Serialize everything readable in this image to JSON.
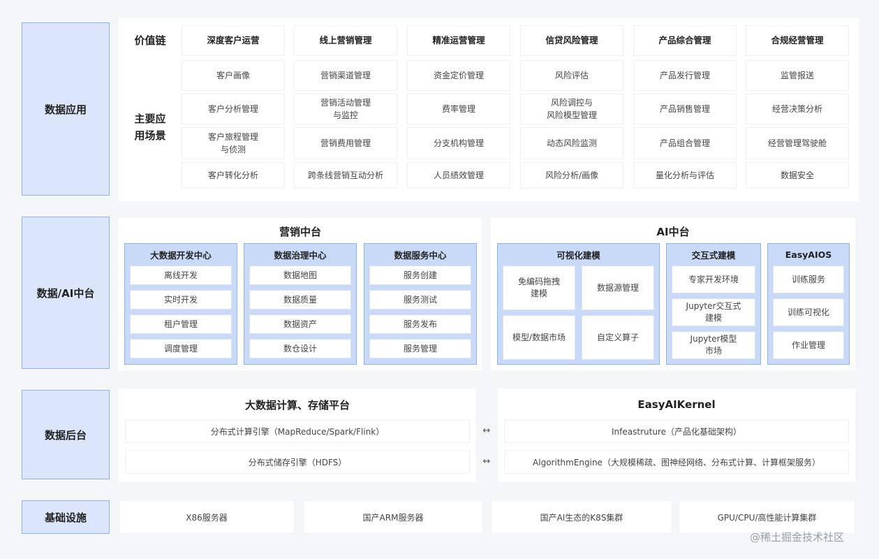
{
  "categories": {
    "app": "数据应用",
    "middle": "数据/AI中台",
    "backend": "数据后台",
    "infra": "基础设施"
  },
  "app": {
    "value_chain_label": "价值链",
    "scenario_label_line1": "主要应",
    "scenario_label_line2": "用场景",
    "columns": [
      {
        "header": "深度客户运营",
        "items": [
          "客户画像",
          "客户分析管理",
          "客户旅程管理\n与侦测",
          "客户转化分析"
        ]
      },
      {
        "header": "线上营销管理",
        "items": [
          "营销渠道管理",
          "营销活动管理\n与监控",
          "营销费用管理",
          "跨条线营销互动分析"
        ]
      },
      {
        "header": "精准运营管理",
        "items": [
          "资金定价管理",
          "费率管理",
          "分支机构管理",
          "人员绩效管理"
        ]
      },
      {
        "header": "信贷风险管理",
        "items": [
          "风险评估",
          "风险调控与\n风险模型管理",
          "动态风险监测",
          "风险分析/画像"
        ]
      },
      {
        "header": "产品综合管理",
        "items": [
          "产品发行管理",
          "产品销售管理",
          "产品组合管理",
          "量化分析与评估"
        ]
      },
      {
        "header": "合规经营管理",
        "items": [
          "监管报送",
          "经营决策分析",
          "经营管理驾驶舱",
          "数据安全"
        ]
      }
    ]
  },
  "middle": {
    "marketing_title": "营销中台",
    "ai_title": "AI中台",
    "groups": [
      {
        "title": "大数据开发中心",
        "items": [
          "离线开发",
          "实时开发",
          "租户管理",
          "调度管理"
        ]
      },
      {
        "title": "数据治理中心",
        "items": [
          "数据地图",
          "数据质量",
          "数据资产",
          "数仓设计"
        ]
      },
      {
        "title": "数据服务中心",
        "items": [
          "服务创建",
          "服务测试",
          "服务发布",
          "服务管理"
        ]
      }
    ],
    "visual": {
      "title": "可视化建模",
      "items": [
        "免编码拖拽\n建模",
        "数据源管理",
        "模型/数据市场",
        "自定义算子"
      ]
    },
    "interactive": {
      "title": "交互式建模",
      "items": [
        "专家开发环境",
        "Jupyter交互式\n建模",
        "Jupyter模型\n市场"
      ]
    },
    "easyaios": {
      "title": "EasyAIOS",
      "items": [
        "训练服务",
        "训练可视化",
        "作业管理"
      ]
    }
  },
  "backend": {
    "left_title": "大数据计算、存储平台",
    "right_title": "EasyAIKernel",
    "left_rows": [
      "分布式计算引擎（MapReduce/Spark/Flink）",
      "分布式储存引擎（HDFS）"
    ],
    "right_rows": [
      "Infeastruture（产品化基础架构）",
      "AlgorithmEngine（大规模稀疏、图神经网络、分布式计算、计算框架服务）"
    ],
    "arrow": "↔"
  },
  "infra": {
    "items": [
      "X86服务器",
      "国产ARM服务器",
      "国产AI生态的K8S集群",
      "GPU/CPU/高性能计算集群"
    ]
  },
  "watermark": "@稀土掘金技术社区",
  "colors": {
    "category_fill": "#dbe6fb",
    "category_border": "#8fb1ec",
    "group_fill": "#c9daf8"
  }
}
